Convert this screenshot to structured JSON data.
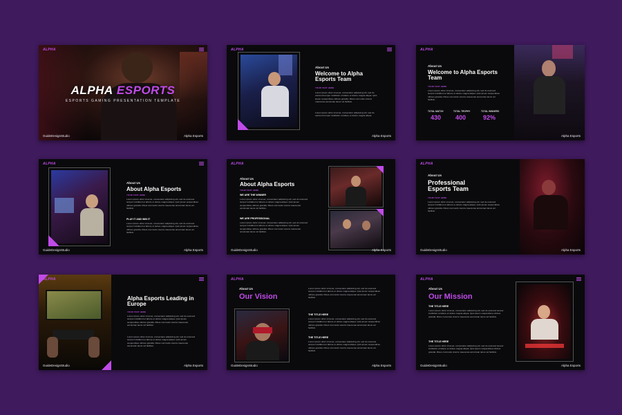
{
  "brand": "ALPHA",
  "studio": "GuideDesignStudio",
  "footer": "Alpha Esports",
  "lorem": "Lorem ipsum dolor sit amet, consectetur adipiscing elit, sed do eiusmod tempor incididunt ut labore et dolore magna aliqua. Quis ipsum suspendisse ultrices gravida. Risus commodo viverra maecenas accumsan lacus vel facilisis.",
  "lorem_short": "Lorem ipsum dolor sit amet, consectetur adipiscing elit, sed do eiusmod tempor incididunt ut labore et dolore magna aliqua.",
  "sub_tag": "YOUR TEXT HERE",
  "colors": {
    "background": "#3f1a5c",
    "accent": "#c04be8",
    "slide": "#0a0a0c"
  },
  "slides": {
    "s1": {
      "title_a": "ALPHA",
      "title_b": "ESPORTS",
      "subtitle": "ESPORTS GAMING PRESENTATION TEMPLATE"
    },
    "s2": {
      "label": "About Us",
      "title": "Welcome to Alpha Esports Team"
    },
    "s3": {
      "label": "About Us",
      "title": "Welcome to Alpha Esports Team",
      "stats": [
        {
          "label": "TOTAL MATCH",
          "value": "430"
        },
        {
          "label": "TOTAL TROPHY",
          "value": "400"
        },
        {
          "label": "TOTAL WINNERS",
          "value": "92%"
        }
      ]
    },
    "s4": {
      "label": "About Us",
      "title": "About Alpha Esports",
      "head": "PLAY IT AND WIN IT"
    },
    "s5": {
      "label": "About Us",
      "title": "About Alpha Esports",
      "head1": "WE ARE THE WINNER",
      "head2": "WE ARE PROFESSIONAL"
    },
    "s6": {
      "label": "About Us",
      "title": "Professional Esports Team"
    },
    "s7": {
      "title": "Alpha Esports Leading in Europe"
    },
    "s8": {
      "label": "About Us",
      "title": "Our Vision",
      "head1": "THE TITLE HERE",
      "head2": "THE TITLE HERE"
    },
    "s9": {
      "label": "About Us",
      "title": "Our Mission",
      "head1": "THE TITLE HERE",
      "head2": "THE TITLE HERE"
    }
  }
}
